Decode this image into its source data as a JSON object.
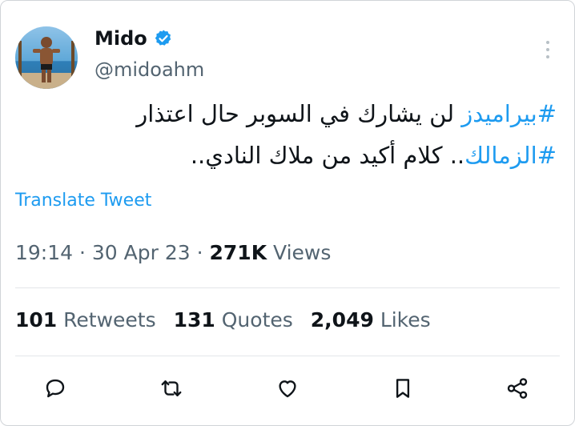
{
  "author": {
    "name": "Mido",
    "handle": "@midoahm",
    "verified": true,
    "avatar": "avatar-photo"
  },
  "tweet": {
    "line1_hashtag": "#بيراميدز",
    "line1_text": " لن يشارك في السوبر حال اعتذار",
    "line2_hashtag": "#الزمالك",
    "line2_text": ".. كلام أكيد من ملاك النادي.."
  },
  "translate_label": "Translate Tweet",
  "meta": {
    "time": "19:14",
    "sep1": " · ",
    "date": "30 Apr 23",
    "sep2": " · ",
    "views_count": "271K",
    "views_label": " Views"
  },
  "stats": {
    "retweets_count": "101",
    "retweets_label": "Retweets",
    "quotes_count": "131",
    "quotes_label": "Quotes",
    "likes_count": "2,049",
    "likes_label": "Likes"
  },
  "colors": {
    "accent": "#1d9bf0",
    "text": "#0f1419",
    "muted": "#536471"
  },
  "icons": [
    "verified-badge-icon",
    "more-options-icon",
    "reply-icon",
    "retweet-icon",
    "like-icon",
    "bookmark-icon",
    "share-icon"
  ]
}
